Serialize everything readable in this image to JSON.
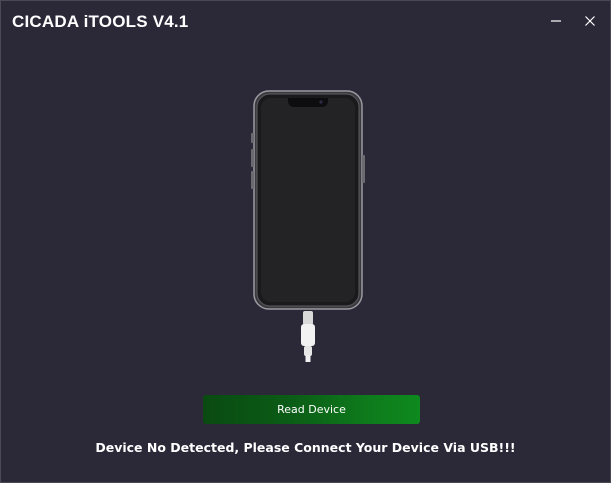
{
  "window": {
    "title": "CICADA iTOOLS V4.1",
    "background": "#2b2838"
  },
  "titlebar": {
    "minimize_icon": "minimize-icon",
    "close_icon": "close-icon"
  },
  "device_illustration": {
    "icon": "iphone-with-lightning-cable"
  },
  "actions": {
    "read_device_label": "Read Device",
    "read_device_color": "#0e7a1c"
  },
  "status": {
    "message": "Device No Detected, Please Connect Your Device Via USB!!!"
  }
}
